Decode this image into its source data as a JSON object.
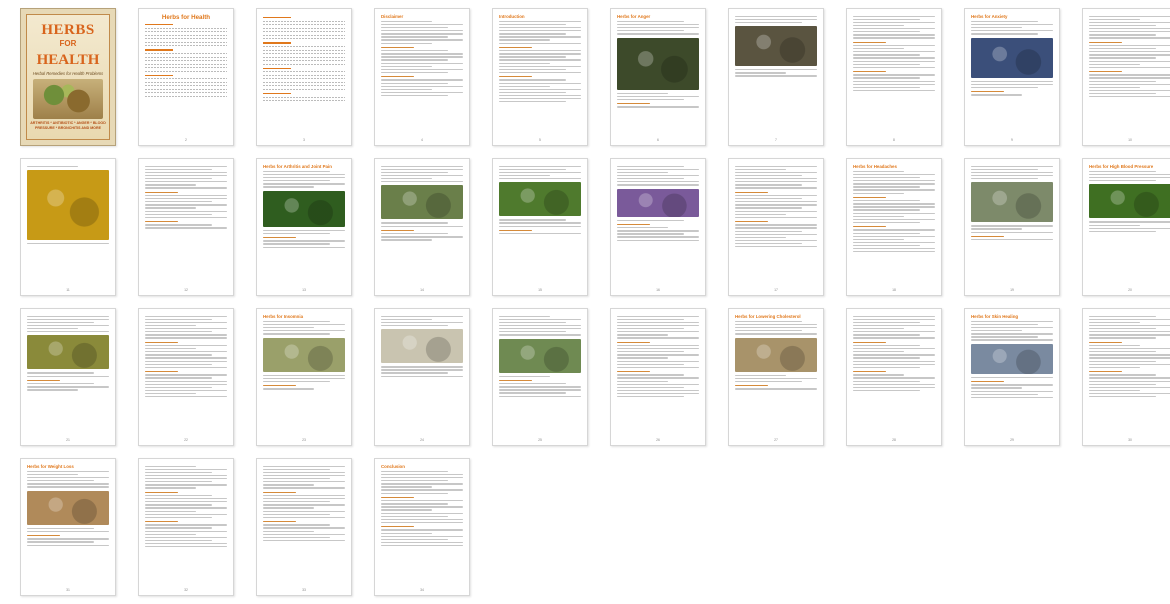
{
  "document": {
    "title": "Herbs for Health",
    "cover": {
      "title_line1": "HERBS",
      "title_line2": "HEALTH",
      "connector": "FOR",
      "subtitle": "Herbal Remedies for Health Problems",
      "tags": "ARTHRITIS * ANTIBIOTIC * ANGER * BLOOD PRESSURE * BRONCHITIS AND MORE"
    },
    "pages": [
      {
        "kind": "cover"
      },
      {
        "kind": "toc",
        "title": "Herbs for Health",
        "lines": 18
      },
      {
        "kind": "toc",
        "title": "",
        "lines": 20
      },
      {
        "kind": "text",
        "title": "Disclaimer",
        "lines": 24
      },
      {
        "kind": "text",
        "title": "Introduction",
        "lines": 26
      },
      {
        "kind": "photo",
        "title": "Herbs for Anger",
        "lines": 10,
        "photo": "#3d4a2a",
        "photo_h": 52
      },
      {
        "kind": "photo",
        "title": "",
        "lines": 6,
        "photo": "#5a5440",
        "photo_h": 40
      },
      {
        "kind": "text",
        "title": "",
        "lines": 24
      },
      {
        "kind": "photo",
        "title": "Herbs for Anxiety",
        "lines": 10,
        "photo": "#3b4f7a",
        "photo_h": 40
      },
      {
        "kind": "text",
        "title": "",
        "lines": 26
      },
      {
        "kind": "photo",
        "title": "",
        "lines": 2,
        "photo": "#c79a16",
        "photo_h": 70
      },
      {
        "kind": "text",
        "title": "",
        "lines": 20
      },
      {
        "kind": "photo",
        "title": "Herbs for Arthritis and Joint Pain",
        "lines": 12,
        "photo": "#2f5d1f",
        "photo_h": 36
      },
      {
        "kind": "photo",
        "title": "",
        "lines": 12,
        "photo": "#6a7f4a",
        "photo_h": 34
      },
      {
        "kind": "photo",
        "title": "",
        "lines": 10,
        "photo": "#4f7a2d",
        "photo_h": 34
      },
      {
        "kind": "photo",
        "title": "",
        "lines": 14,
        "photo": "#7a5a9a",
        "photo_h": 28
      },
      {
        "kind": "text",
        "title": "",
        "lines": 26
      },
      {
        "kind": "text",
        "title": "Herbs for Headaches",
        "lines": 26
      },
      {
        "kind": "photo",
        "title": "",
        "lines": 10,
        "photo": "#7d8a6a",
        "photo_h": 40
      },
      {
        "kind": "photo",
        "title": "Herbs for High Blood Pressure",
        "lines": 8,
        "photo": "#3f6f22",
        "photo_h": 34
      },
      {
        "kind": "photo",
        "title": "",
        "lines": 12,
        "photo": "#8a8a3a",
        "photo_h": 34
      },
      {
        "kind": "text",
        "title": "",
        "lines": 26
      },
      {
        "kind": "photo",
        "title": "Herbs for Insomnia",
        "lines": 10,
        "photo": "#9aa06a",
        "photo_h": 34
      },
      {
        "kind": "photo",
        "title": "",
        "lines": 8,
        "photo": "#c9c4b0",
        "photo_h": 34
      },
      {
        "kind": "photo",
        "title": "",
        "lines": 14,
        "photo": "#6f8a52",
        "photo_h": 34
      },
      {
        "kind": "text",
        "title": "",
        "lines": 26
      },
      {
        "kind": "photo",
        "title": "Herbs for Lowering Cholesterol",
        "lines": 10,
        "photo": "#a8936a",
        "photo_h": 34
      },
      {
        "kind": "text",
        "title": "",
        "lines": 24
      },
      {
        "kind": "photo",
        "title": "Herbs for Skin Healing",
        "lines": 14,
        "photo": "#7a8aa0",
        "photo_h": 30
      },
      {
        "kind": "text",
        "title": "",
        "lines": 26
      },
      {
        "kind": "photo",
        "title": "Herbs for Weight Loss",
        "lines": 12,
        "photo": "#b08a5a",
        "photo_h": 34
      },
      {
        "kind": "text",
        "title": "",
        "lines": 26
      },
      {
        "kind": "text",
        "title": "",
        "lines": 24
      },
      {
        "kind": "text",
        "title": "Conclusion",
        "lines": 24
      }
    ]
  },
  "colors": {
    "accent": "#e0781c",
    "text_line": "#c7c7c7",
    "border": "#d6d6d6"
  }
}
